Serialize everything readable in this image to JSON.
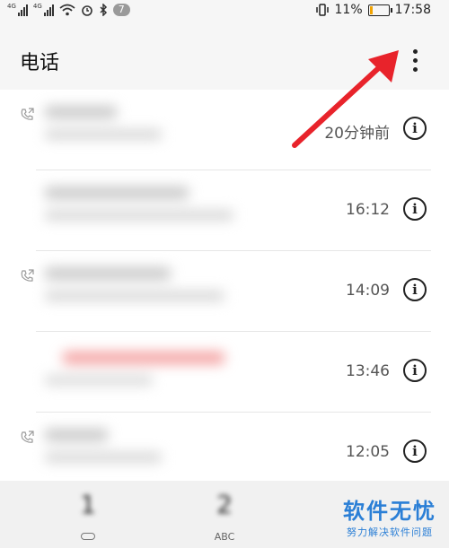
{
  "status_bar": {
    "signal1_label": "4G",
    "signal2_label": "4G",
    "notification_count": "7",
    "battery_percent": "11%",
    "time": "17:58"
  },
  "app_bar": {
    "title": "电话",
    "more_icon": "more-vertical-icon"
  },
  "call_log": [
    {
      "time": "20分钟前",
      "has_call_icon": true,
      "name_color": "#cfcfcf"
    },
    {
      "time": "16:12",
      "has_call_icon": false,
      "name_color": "#cfcfcf"
    },
    {
      "time": "14:09",
      "has_call_icon": true,
      "name_color": "#cfcfcf"
    },
    {
      "time": "13:46",
      "has_call_icon": false,
      "name_color": "#f27a7a"
    },
    {
      "time": "12:05",
      "has_call_icon": true,
      "name_color": "#cfcfcf"
    }
  ],
  "dialpad_hint": {
    "key1_digit": "1",
    "key1_sub_icon": "voicemail-icon",
    "key2_digit": "2",
    "key2_sub": "ABC"
  },
  "watermark": {
    "main": "软件无忧",
    "sub": "努力解决软件问题"
  },
  "colors": {
    "annotation_arrow": "#e8232b",
    "watermark": "#2b7fd6",
    "missed_call": "#f27a7a"
  }
}
